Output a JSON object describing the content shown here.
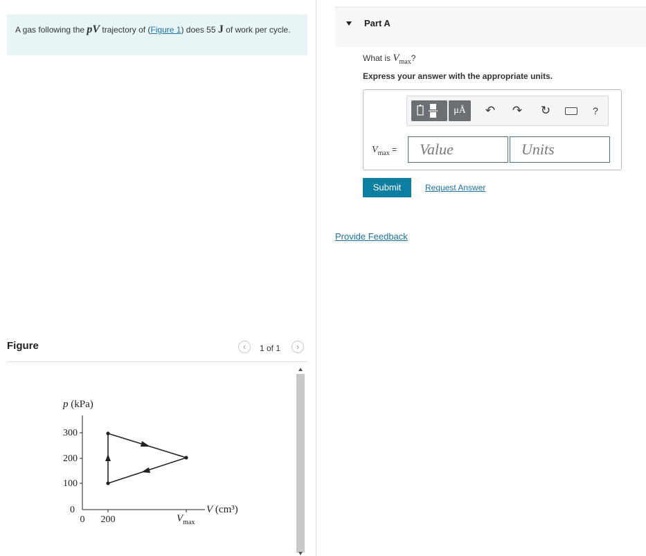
{
  "problem": {
    "text_before": "A gas following the ",
    "symbol_p": "p",
    "symbol_v": "V",
    "text_mid": " trajectory of (",
    "figure_link": "Figure 1",
    "text_after": ") does 55 ",
    "unit_symbol": "J",
    "text_end": " of work per cycle."
  },
  "figure": {
    "heading": "Figure",
    "counter": "1 of 1",
    "prev_icon": "chevron-left-icon",
    "next_icon": "chevron-right-icon"
  },
  "chart_data": {
    "type": "line",
    "ylabel": "p (kPa)",
    "xlabel": "V (cm³)",
    "y_ticks": [
      "0",
      "100",
      "200",
      "300"
    ],
    "x_ticks": [
      "0",
      "200",
      "Vmax"
    ],
    "ylim": [
      0,
      300
    ],
    "points": [
      {
        "x": 200,
        "y": 100
      },
      {
        "x": 200,
        "y": 300
      },
      {
        "x": "Vmax",
        "y": 200
      }
    ],
    "direction": "clockwise: 100→300 at V=200, then 300→200 toward Vmax, then back to 100 at V=200"
  },
  "partA": {
    "title": "Part A",
    "question_prefix": "What is ",
    "question_var": "V",
    "question_sub": "max",
    "question_suffix": "?",
    "instruction": "Express your answer with the appropriate units.",
    "label_var": "V",
    "label_sub": "max",
    "label_eq": " =",
    "value_placeholder": "Value",
    "units_placeholder": "Units",
    "units_button": "μÅ",
    "help_label": "?",
    "submit": "Submit",
    "request_answer": "Request Answer",
    "provide_feedback": "Provide Feedback"
  },
  "colors": {
    "statement_bg": "#e8f5f6",
    "submit_bg": "#0d7fa3",
    "link": "#1a73a8",
    "toolbar_button": "#6c6f73"
  }
}
